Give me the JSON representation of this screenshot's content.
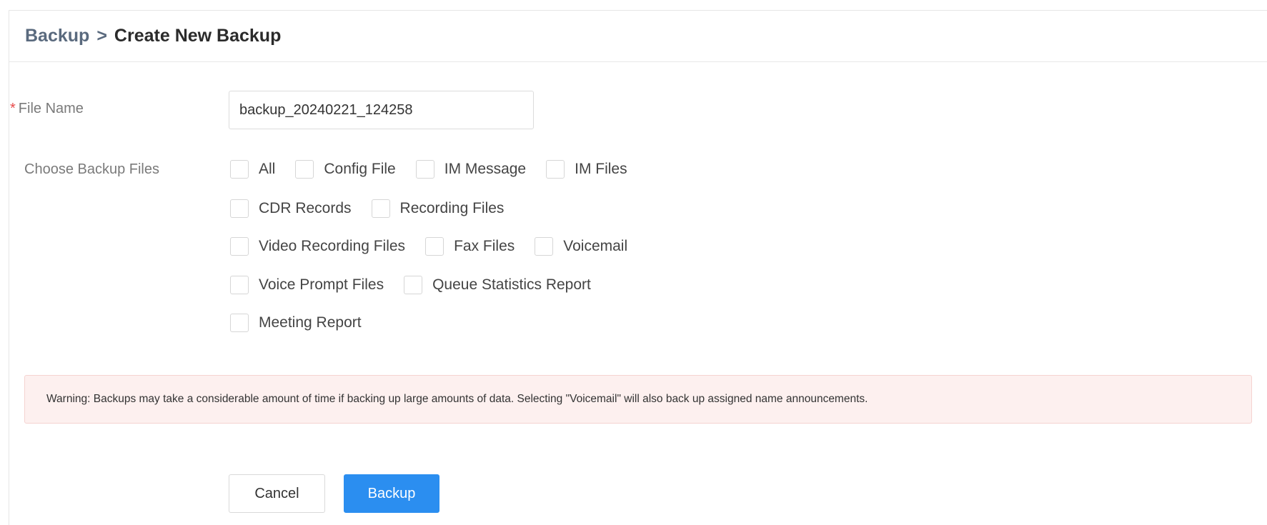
{
  "breadcrumb": {
    "root": "Backup",
    "separator": ">",
    "current": "Create New Backup"
  },
  "form": {
    "file_name": {
      "required_mark": "*",
      "label": "File Name",
      "value": "backup_20240221_124258"
    },
    "backup_files": {
      "label": "Choose Backup Files",
      "rows": [
        [
          {
            "label": "All",
            "checked": false
          },
          {
            "label": "Config File",
            "checked": false
          },
          {
            "label": "IM Message",
            "checked": false
          },
          {
            "label": "IM Files",
            "checked": false
          }
        ],
        [
          {
            "label": "CDR Records",
            "checked": false
          },
          {
            "label": "Recording Files",
            "checked": false
          }
        ],
        [
          {
            "label": "Video Recording Files",
            "checked": false
          },
          {
            "label": "Fax Files",
            "checked": false
          },
          {
            "label": "Voicemail",
            "checked": false
          }
        ],
        [
          {
            "label": "Voice Prompt Files",
            "checked": false
          },
          {
            "label": "Queue Statistics Report",
            "checked": false
          }
        ],
        [
          {
            "label": "Meeting Report",
            "checked": false
          }
        ]
      ]
    }
  },
  "warning": "Warning: Backups may take a considerable amount of time if backing up large amounts of data. Selecting \"Voicemail\" will also back up assigned name announcements.",
  "actions": {
    "cancel_label": "Cancel",
    "backup_label": "Backup"
  },
  "colors": {
    "primary": "#2b8ef0",
    "required": "#e84a4a",
    "warning_bg": "#fdf0ef"
  }
}
